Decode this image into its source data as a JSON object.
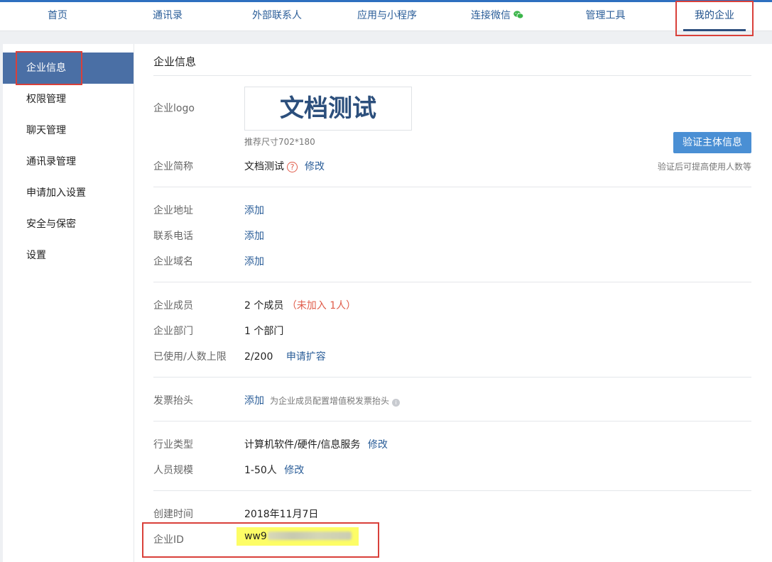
{
  "topnav": {
    "items": [
      {
        "label": "首页"
      },
      {
        "label": "通讯录"
      },
      {
        "label": "外部联系人"
      },
      {
        "label": "应用与小程序"
      },
      {
        "label": "连接微信",
        "icon": "wechat-icon"
      },
      {
        "label": "管理工具"
      },
      {
        "label": "我的企业",
        "active": true
      }
    ]
  },
  "sidebar": {
    "items": [
      {
        "label": "企业信息",
        "active": true
      },
      {
        "label": "权限管理"
      },
      {
        "label": "聊天管理"
      },
      {
        "label": "通讯录管理"
      },
      {
        "label": "申请加入设置"
      },
      {
        "label": "安全与保密"
      },
      {
        "label": "设置"
      }
    ]
  },
  "content": {
    "title": "企业信息",
    "logo": {
      "label": "企业logo",
      "text": "文档测试",
      "hint": "推荐尺寸702*180"
    },
    "short_name": {
      "label": "企业简称",
      "value": "文档测试",
      "help": "?",
      "action": "修改"
    },
    "verify": {
      "button": "验证主体信息",
      "hint": "验证后可提高使用人数等"
    },
    "address": {
      "label": "企业地址",
      "action": "添加"
    },
    "phone": {
      "label": "联系电话",
      "action": "添加"
    },
    "domain": {
      "label": "企业域名",
      "action": "添加"
    },
    "members": {
      "label": "企业成员",
      "value": "2 个成员",
      "note": "（未加入 1人）"
    },
    "departments": {
      "label": "企业部门",
      "value": "1 个部门"
    },
    "quota": {
      "label": "已使用/人数上限",
      "value": "2/200",
      "action": "申请扩容"
    },
    "invoice": {
      "label": "发票抬头",
      "action": "添加",
      "hint": "为企业成员配置增值税发票抬头"
    },
    "industry": {
      "label": "行业类型",
      "value": "计算机软件/硬件/信息服务",
      "action": "修改"
    },
    "size": {
      "label": "人员规模",
      "value": "1-50人",
      "action": "修改"
    },
    "created": {
      "label": "创建时间",
      "value": "2018年11月7日"
    },
    "corp_id": {
      "label": "企业ID",
      "value_prefix": "ww9"
    }
  },
  "colors": {
    "accent": "#4a6fa5",
    "link": "#2a5d98",
    "button": "#4a8fd4",
    "highlight": "#fdfd66",
    "annotation_red": "#d9403a",
    "warn": "#e05c4a"
  }
}
